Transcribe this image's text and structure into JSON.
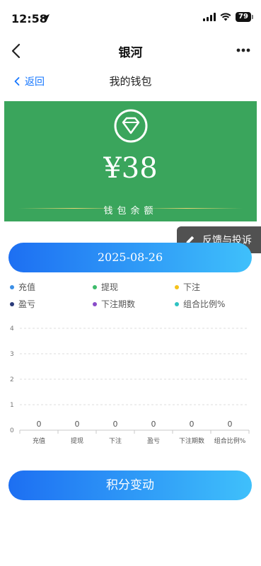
{
  "status_bar": {
    "time": "12:58",
    "battery": "79"
  },
  "nav": {
    "title": "银河"
  },
  "sub_header": {
    "back_label": "返回",
    "title": "我的钱包"
  },
  "wallet": {
    "balance": "¥38",
    "balance_label": "钱包余额"
  },
  "feedback": {
    "label": "反馈与投诉"
  },
  "date_selector": {
    "value": "2025-08-26"
  },
  "legend": [
    {
      "label": "充值",
      "color": "#3b8fe6"
    },
    {
      "label": "提现",
      "color": "#3dbb6b"
    },
    {
      "label": "下注",
      "color": "#f5c21b"
    },
    {
      "label": "盈亏",
      "color": "#2a3b7a"
    },
    {
      "label": "下注期数",
      "color": "#8a4cc9"
    },
    {
      "label": "组合比例%",
      "color": "#2ec2c2"
    }
  ],
  "chart_data": {
    "type": "bar",
    "categories": [
      "充值",
      "提现",
      "下注",
      "盈亏",
      "下注期数",
      "组合比例%"
    ],
    "values": [
      0,
      0,
      0,
      0,
      0,
      0
    ],
    "y_ticks": [
      "4",
      "3",
      "2",
      "1",
      "0"
    ],
    "ylim": [
      0,
      4
    ],
    "grid": true
  },
  "points_button": {
    "label": "积分变动"
  }
}
